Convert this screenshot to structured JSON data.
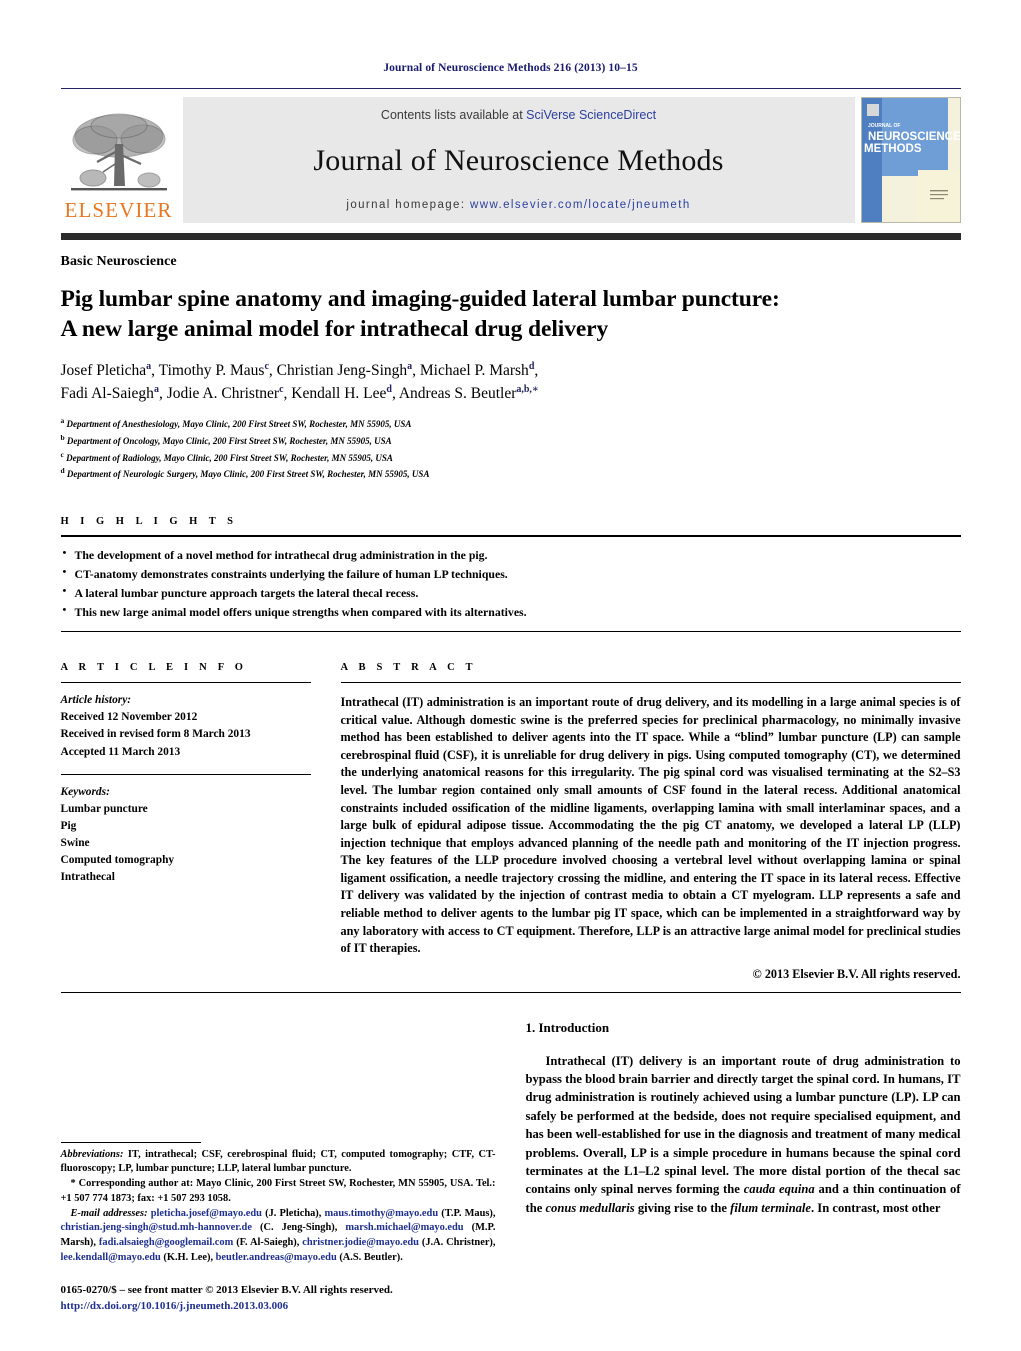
{
  "running_head": "Journal of Neuroscience Methods 216 (2013) 10–15",
  "masthead": {
    "contents_prefix": "Contents lists available at ",
    "contents_link": "SciVerse ScienceDirect",
    "journal_title": "Journal of Neuroscience Methods",
    "homepage_prefix": "journal homepage: ",
    "homepage_url": "www.elsevier.com/locate/jneumeth",
    "publisher_logo_text": "ELSEVIER",
    "cover_line1": "JOURNAL OF",
    "cover_line2": "NEUROSCIENCE",
    "cover_line3": "METHODS",
    "link_color": "#2b3f9e",
    "logo_color": "#E87722"
  },
  "article": {
    "section_label": "Basic Neuroscience",
    "title_line1": "Pig lumbar spine anatomy and imaging-guided lateral lumbar puncture:",
    "title_line2": "A new large animal model for intrathecal drug delivery",
    "authors_line1": "Josef Pleticha<sup>a</sup>, Timothy P. Maus<sup>c</sup>, Christian Jeng-Singh<sup>a</sup>, Michael P. Marsh<sup>d</sup>,",
    "authors_line2": "Fadi Al-Saiegh<sup>a</sup>, Jodie A. Christner<sup>c</sup>, Kendall H. Lee<sup>d</sup>, Andreas S. Beutler<sup>a,b,∗</sup>",
    "affiliations": [
      "<sup>a</sup> Department of Anesthesiology, Mayo Clinic, 200 First Street SW, Rochester, MN 55905, USA",
      "<sup>b</sup> Department of Oncology, Mayo Clinic, 200 First Street SW, Rochester, MN 55905, USA",
      "<sup>c</sup> Department of Radiology, Mayo Clinic, 200 First Street SW, Rochester, MN 55905, USA",
      "<sup>d</sup> Department of Neurologic Surgery, Mayo Clinic, 200 First Street SW, Rochester, MN 55905, USA"
    ]
  },
  "highlights": {
    "heading": "H I G H L I G H T S",
    "items": [
      "The development of a novel method for intrathecal drug administration in the pig.",
      "CT-anatomy demonstrates constraints underlying the failure of human LP techniques.",
      "A lateral lumbar puncture approach targets the lateral thecal recess.",
      "This new large animal model offers unique strengths when compared with its alternatives."
    ]
  },
  "article_info": {
    "heading": "A R T I C L E    I N F O",
    "history_label": "Article history:",
    "history": [
      "Received 12 November 2012",
      "Received in revised form 8 March 2013",
      "Accepted 11 March 2013"
    ],
    "keywords_label": "Keywords:",
    "keywords": [
      "Lumbar puncture",
      "Pig",
      "Swine",
      "Computed tomography",
      "Intrathecal"
    ]
  },
  "abstract": {
    "heading": "A B S T R A C T",
    "body": "Intrathecal (IT) administration is an important route of drug delivery, and its modelling in a large animal species is of critical value. Although domestic swine is the preferred species for preclinical pharmacology, no minimally invasive method has been established to deliver agents into the IT space. While a “blind” lumbar puncture (LP) can sample cerebrospinal fluid (CSF), it is unreliable for drug delivery in pigs. Using computed tomography (CT), we determined the underlying anatomical reasons for this irregularity. The pig spinal cord was visualised terminating at the S2–S3 level. The lumbar region contained only small amounts of CSF found in the lateral recess. Additional anatomical constraints included ossification of the midline ligaments, overlapping lamina with small interlaminar spaces, and a large bulk of epidural adipose tissue. Accommodating the the pig CT anatomy, we developed a lateral LP (LLP) injection technique that employs advanced planning of the needle path and monitoring of the IT injection progress. The key features of the LLP procedure involved choosing a vertebral level without overlapping lamina or spinal ligament ossification, a needle trajectory crossing the midline, and entering the IT space in its lateral recess. Effective IT delivery was validated by the injection of contrast media to obtain a CT myelogram. LLP represents a safe and reliable method to deliver agents to the lumbar pig IT space, which can be implemented in a straightforward way by any laboratory with access to CT equipment. Therefore, LLP is an attractive large animal model for preclinical studies of IT therapies.",
    "copyright": "© 2013 Elsevier B.V. All rights reserved."
  },
  "introduction": {
    "heading": "1.  Introduction",
    "paragraph_html": "Intrathecal (IT) delivery is an important route of drug administration to bypass the blood brain barrier and directly target the spinal cord. In humans, IT drug administration is routinely achieved using a lumbar puncture (LP). LP can safely be performed at the bedside, does not require specialised equipment, and has been well-established for use in the diagnosis and treatment of many medical problems. Overall, LP is a simple procedure in humans because the spinal cord terminates at the L1–L2 spinal level. The more distal portion of the thecal sac contains only spinal nerves forming the <i>cauda equina</i> and a thin continuation of the <i>conus medullaris</i> giving rise to the <i>filum terminale</i>. In contrast, most other"
  },
  "footnotes": {
    "abbreviations_html": "<span class=\"it\">Abbreviations:</span> IT, intrathecal; CSF, cerebrospinal fluid; CT, computed tomography; CTF, CT-fluoroscopy; LP, lumbar puncture; LLP, lateral lumbar puncture.",
    "corresponding_html": "* Corresponding author at: Mayo Clinic, 200 First Street SW, Rochester, MN 55905, USA. Tel.: +1 507 774 1873; fax: +1 507 293 1058.",
    "emails_html": "<span class=\"it\">E-mail addresses:</span> <span class=\"lnk\">pleticha.josef@mayo.edu</span> (J. Pleticha), <span class=\"lnk\">maus.timothy@mayo.edu</span> (T.P. Maus), <span class=\"lnk\">christian.jeng-singh@stud.mh-hannover.de</span> (C. Jeng-Singh), <span class=\"lnk\">marsh.michael@mayo.edu</span> (M.P. Marsh), <span class=\"lnk\">fadi.alsaiegh@googlemail.com</span> (F. Al-Saiegh), <span class=\"lnk\">christner.jodie@mayo.edu</span> (J.A. Christner), <span class=\"lnk\">lee.kendall@mayo.edu</span> (K.H. Lee), <span class=\"lnk\">beutler.andreas@mayo.edu</span> (A.S. Beutler).",
    "issn_line": "0165-0270/$ – see front matter © 2013 Elsevier B.V. All rights reserved.",
    "doi_line": "http://dx.doi.org/10.1016/j.jneumeth.2013.03.006"
  }
}
